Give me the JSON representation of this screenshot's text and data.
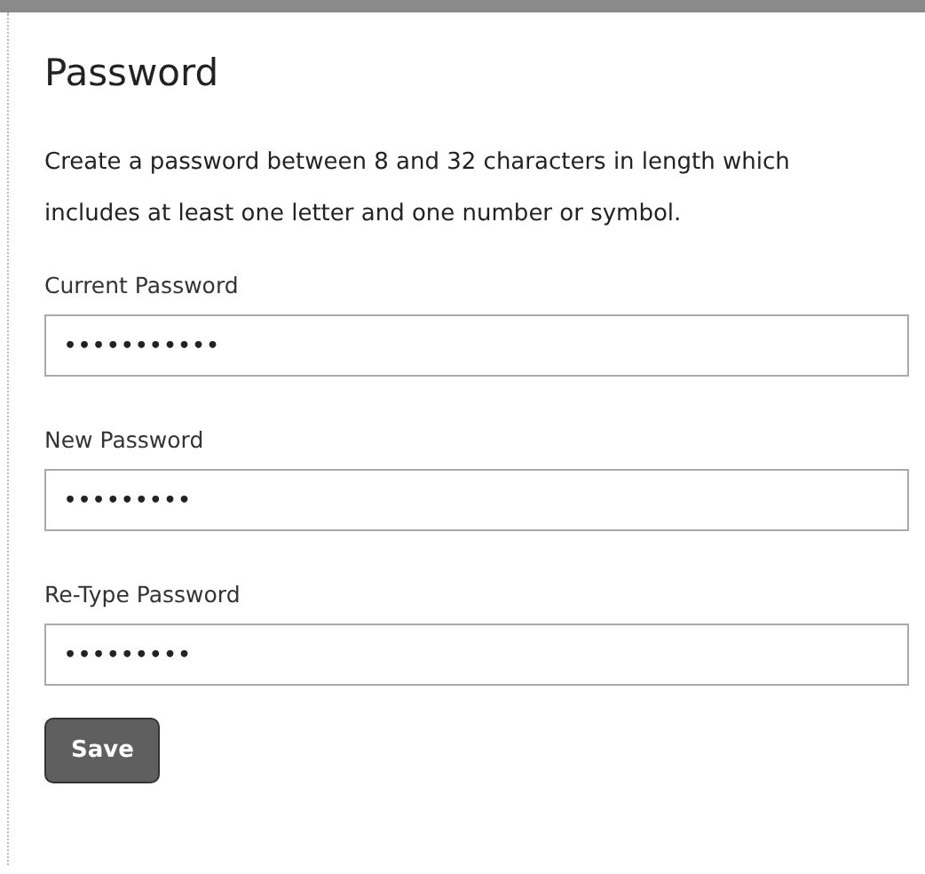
{
  "title": "Password",
  "description": "Create a password between 8 and 32 characters in length which includes at least one letter and one number or symbol.",
  "fields": [
    {
      "label": "Current Password",
      "value": "•••••••••••"
    },
    {
      "label": "New Password",
      "value": "•••••••••"
    },
    {
      "label": "Re-Type Password",
      "value": "•••••••••"
    }
  ],
  "buttons": [
    {
      "label": "Save"
    }
  ]
}
